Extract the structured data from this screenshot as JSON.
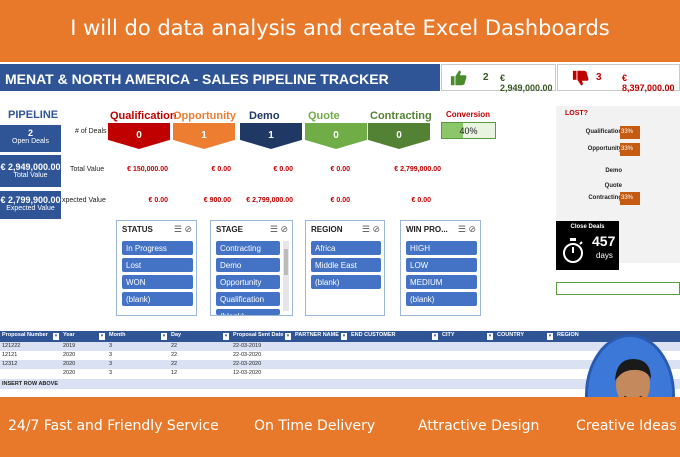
{
  "banner_title": "I will do data analysis and create Excel Dashboards",
  "footer": [
    "24/7 Fast and Friendly Service",
    "On Time Delivery",
    "Attractive Design",
    "Creative Ideas"
  ],
  "header": {
    "title": "MENAT & NORTH AMERICA - SALES PIPELINE TRACKER",
    "won_count": "2",
    "won_amount": "€ 2,949,000.00",
    "lost_count": "3",
    "lost_amount": "€ 8,397,000.00"
  },
  "pipeline": {
    "title": "PIPELINE",
    "open_deals": "2",
    "open_deals_label": "Open Deals",
    "total_value": "€ 2,949,000.00",
    "total_value_label": "Total Value",
    "expected_value": "€ 2,799,900.00",
    "expected_value_label": "Expected Value"
  },
  "row_labels": {
    "deals": "# of Deals",
    "total": "Total Value",
    "expected": "xpected Value"
  },
  "stages": [
    {
      "name": "Qualification",
      "deals": "0",
      "total": "€ 150,000.00",
      "expected": "€ 0.00",
      "color": "#c00000"
    },
    {
      "name": "Opportunity",
      "deals": "1",
      "total": "€ 0.00",
      "expected": "€ 900.00",
      "color": "#ed7d31"
    },
    {
      "name": "Demo",
      "deals": "1",
      "total": "€ 0.00",
      "expected": "€ 2,799,000.00",
      "color": "#203864"
    },
    {
      "name": "Quote",
      "deals": "0",
      "total": "€ 0.00",
      "expected": "€ 0.00",
      "color": "#70ad47"
    },
    {
      "name": "Contracting",
      "deals": "0",
      "total": "€ 2,799,000.00",
      "expected": "€ 0.00",
      "color": "#548235"
    }
  ],
  "conversion": {
    "title": "Conversion",
    "value": "40%",
    "fraction": 0.4
  },
  "lost": {
    "title": "LOST?",
    "rows": [
      {
        "label": "Qualification",
        "pct": "33%",
        "fraction": 0.33
      },
      {
        "label": "Opportunity",
        "pct": "33%",
        "fraction": 0.33
      },
      {
        "label": "Demo",
        "pct": "",
        "fraction": 0
      },
      {
        "label": "Quote",
        "pct": "",
        "fraction": 0
      },
      {
        "label": "Contracting",
        "pct": "33%",
        "fraction": 0.33
      }
    ]
  },
  "close_deals": {
    "title": "Close Deals",
    "value": "457",
    "unit": "days"
  },
  "slicers": [
    {
      "title": "STATUS",
      "items": [
        "In Progress",
        "Lost",
        "WON",
        "(blank)"
      ],
      "scroll": false
    },
    {
      "title": "STAGE",
      "items": [
        "Contracting",
        "Demo",
        "Opportunity",
        "Qualification",
        "(blank)"
      ],
      "scroll": true
    },
    {
      "title": "REGION",
      "items": [
        "Africa",
        "Middle East",
        "(blank)"
      ],
      "scroll": false
    },
    {
      "title": "WIN PRO...",
      "items": [
        "HIGH",
        "LOW",
        "MEDIUM",
        "(blank)"
      ],
      "scroll": false
    }
  ],
  "table": {
    "columns": [
      "Proposal Number",
      "Year",
      "Month",
      "Day",
      "Proposal Sent Date",
      "PARTNER NAME",
      "END CUSTOMER",
      "CITY",
      "COUNTRY",
      "REGION"
    ],
    "rows": [
      [
        "121222",
        "2019",
        "3",
        "22",
        "22-03-2019"
      ],
      [
        "12121",
        "2020",
        "3",
        "22",
        "22-03-2020"
      ],
      [
        "12312",
        "2020",
        "3",
        "22",
        "22-03-2020"
      ],
      [
        "",
        "2020",
        "3",
        "12",
        "12-03-2020"
      ]
    ],
    "insert_label": "INSERT ROW ABOVE"
  },
  "colors": {
    "orange": "#e8792b",
    "navy": "#2f5597",
    "red": "#c00000",
    "green": "#548235"
  }
}
